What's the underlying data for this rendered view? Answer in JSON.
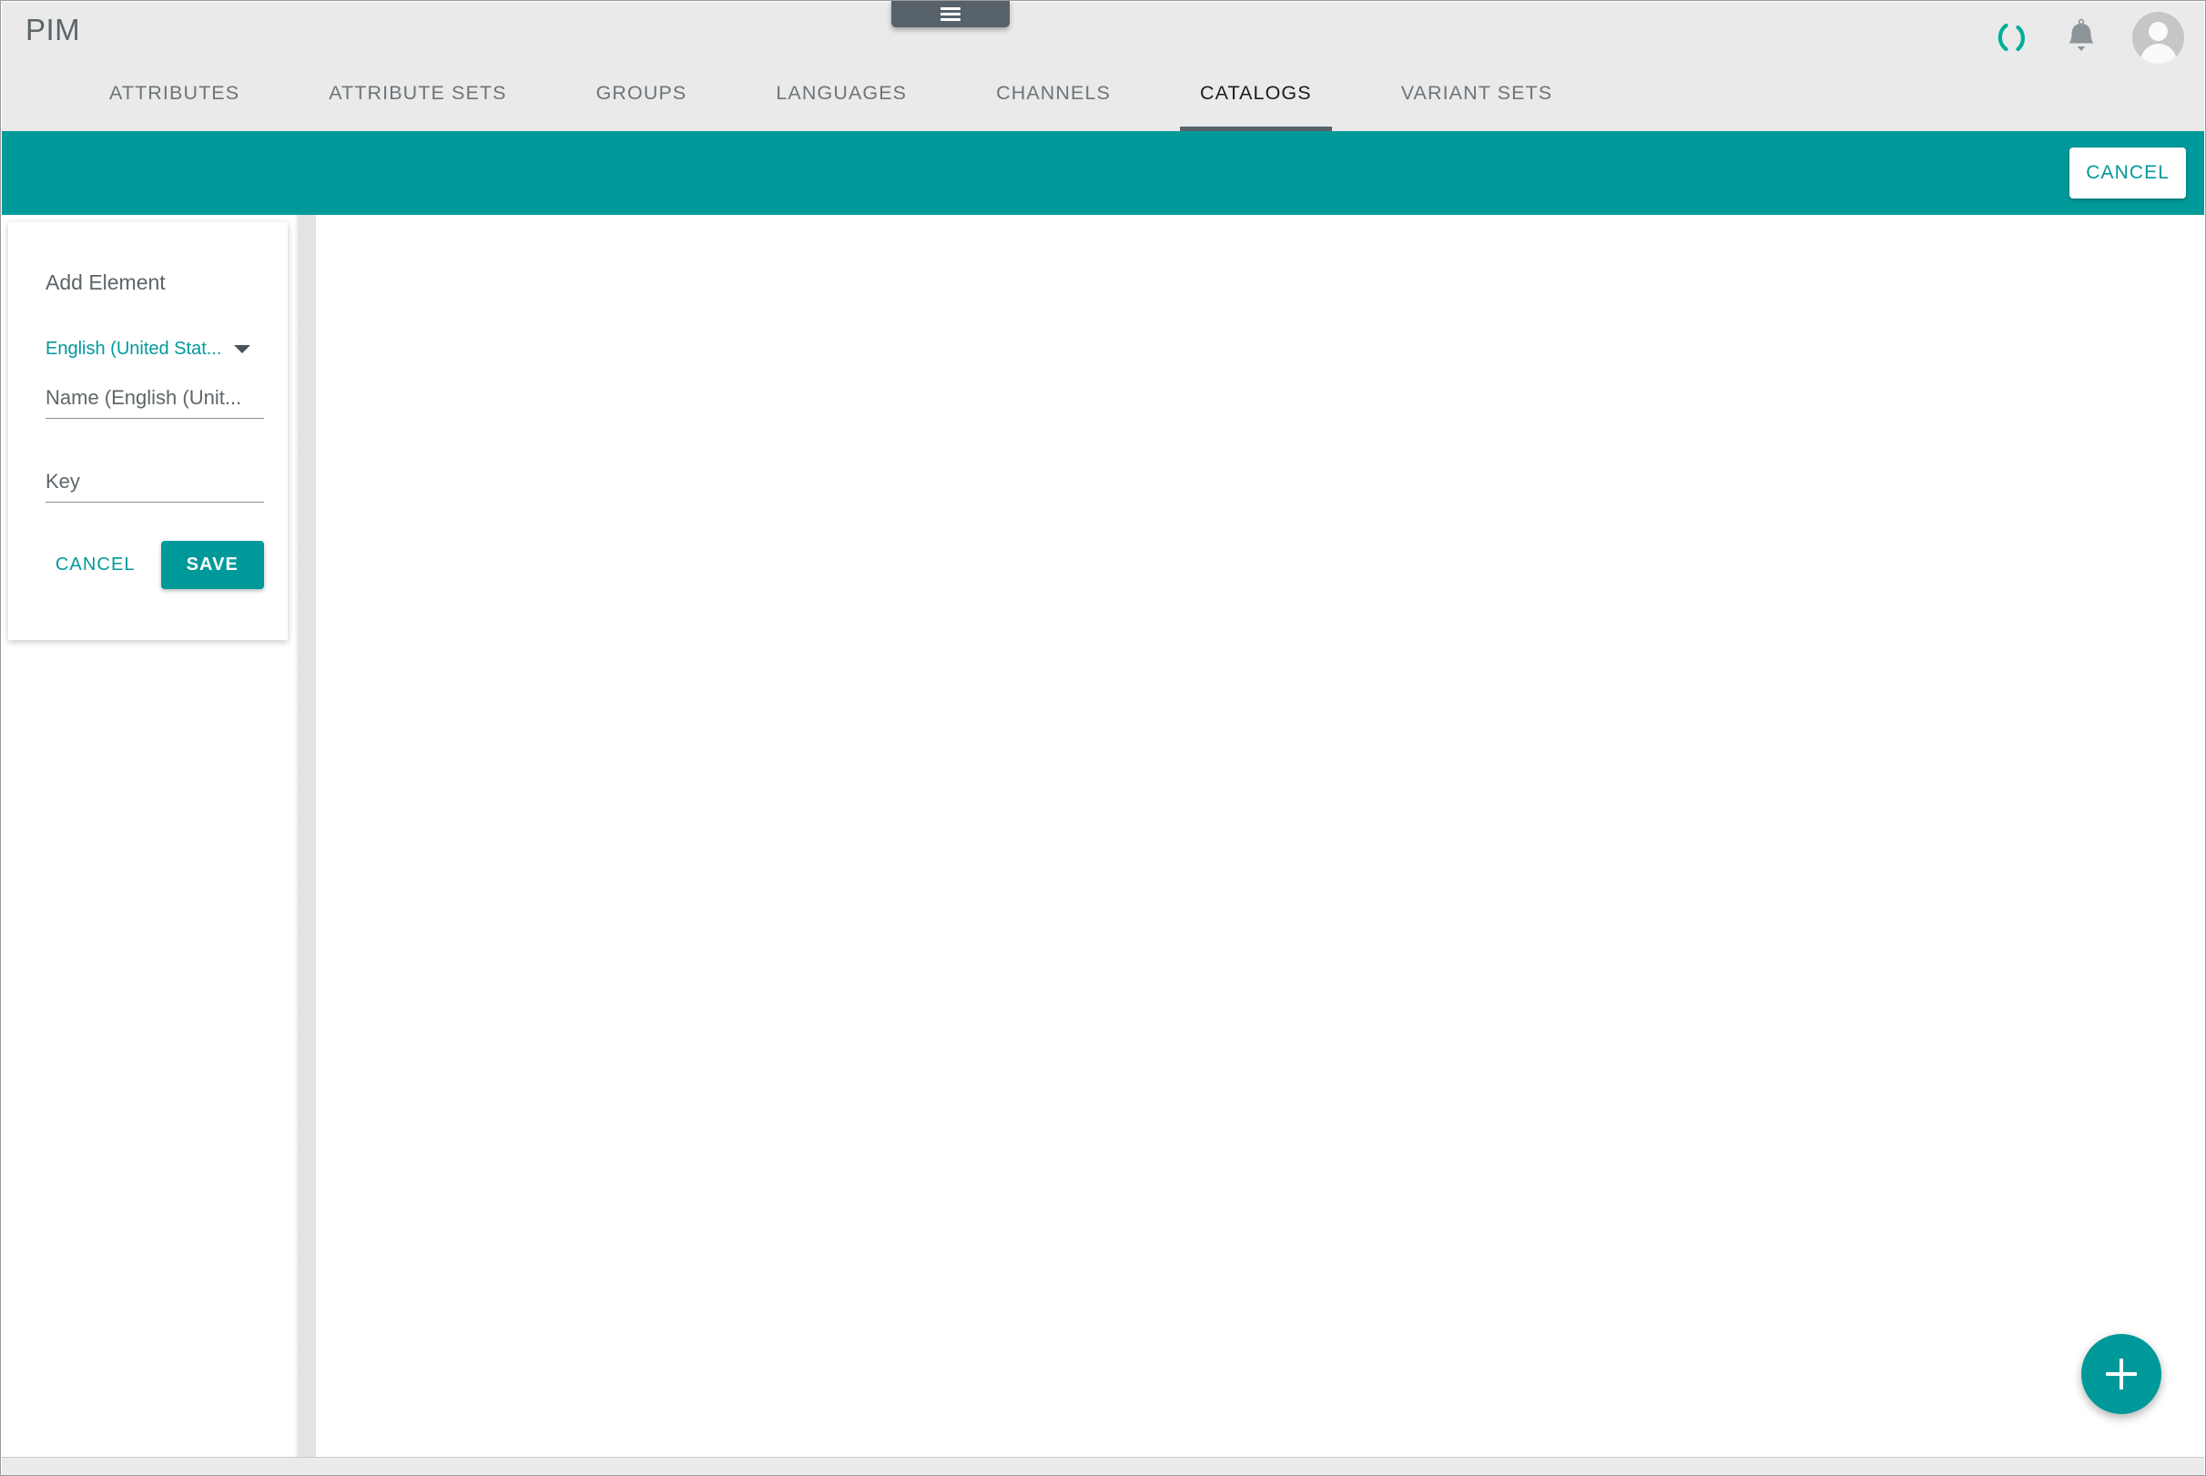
{
  "app": {
    "brand": "PIM",
    "accent_color": "#00999A",
    "header_bg": "#EAEAEA",
    "active_tab_underline_color": "#57626A"
  },
  "header": {
    "menu_tab": {
      "icon": "hamburger-icon"
    },
    "actions": [
      {
        "name": "loading-spinner-icon",
        "label": ""
      },
      {
        "name": "notifications-bell-icon",
        "label": ""
      },
      {
        "name": "user-avatar",
        "label": ""
      }
    ]
  },
  "nav": {
    "tabs": [
      {
        "label": "ATTRIBUTES",
        "active": false
      },
      {
        "label": "ATTRIBUTE SETS",
        "active": false
      },
      {
        "label": "GROUPS",
        "active": false
      },
      {
        "label": "LANGUAGES",
        "active": false
      },
      {
        "label": "CHANNELS",
        "active": false
      },
      {
        "label": "CATALOGS",
        "active": true
      },
      {
        "label": "VARIANT SETS",
        "active": false
      }
    ]
  },
  "action_bar": {
    "cancel_label": "CANCEL"
  },
  "add_element_card": {
    "title": "Add Element",
    "language": {
      "selected": "English (United Stat...",
      "icon": "chevron-down-icon"
    },
    "fields": [
      {
        "name": "element-name",
        "placeholder": "Name (English (Unit...",
        "value": ""
      },
      {
        "name": "element-key",
        "placeholder": "Key",
        "value": ""
      }
    ],
    "cancel_label": "CANCEL",
    "save_label": "SAVE"
  },
  "fab": {
    "icon": "plus-icon",
    "label": "+"
  }
}
